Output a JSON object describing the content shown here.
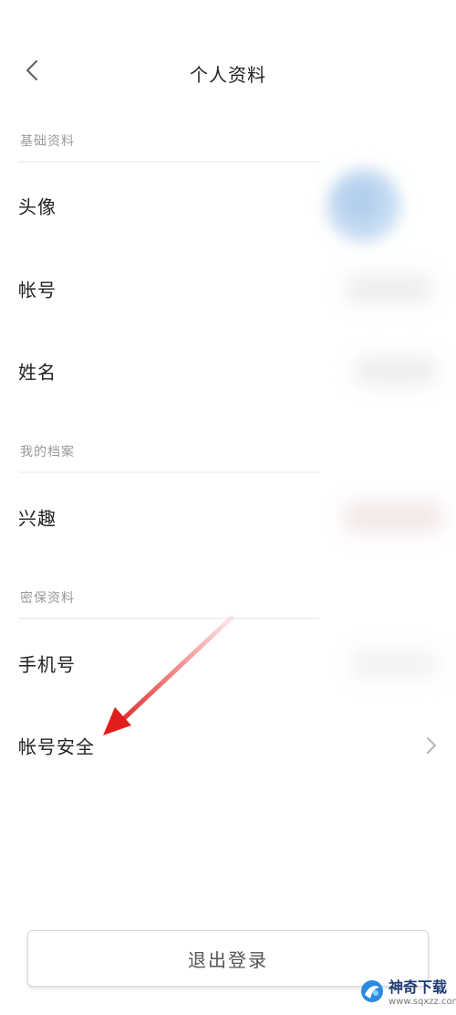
{
  "header": {
    "title": "个人资料",
    "back_icon": "chevron-left-icon"
  },
  "sections": [
    {
      "label": "基础资料",
      "rows": [
        {
          "label": "头像"
        },
        {
          "label": "帐号"
        },
        {
          "label": "姓名"
        }
      ]
    },
    {
      "label": "我的档案",
      "rows": [
        {
          "label": "兴趣"
        }
      ]
    },
    {
      "label": "密保资料",
      "rows": [
        {
          "label": "手机号"
        },
        {
          "label": "帐号安全",
          "icon": "chevron-right-icon"
        }
      ]
    }
  ],
  "footer": {
    "logout_label": "退出登录"
  },
  "watermark": {
    "name": "神奇下载",
    "url": "www.sqxzz.com"
  },
  "colors": {
    "annotation_arrow": "#e11d1d",
    "avatar_blue": "#a9c9eb",
    "text_primary": "#222222",
    "text_muted": "#9a9a9a"
  }
}
